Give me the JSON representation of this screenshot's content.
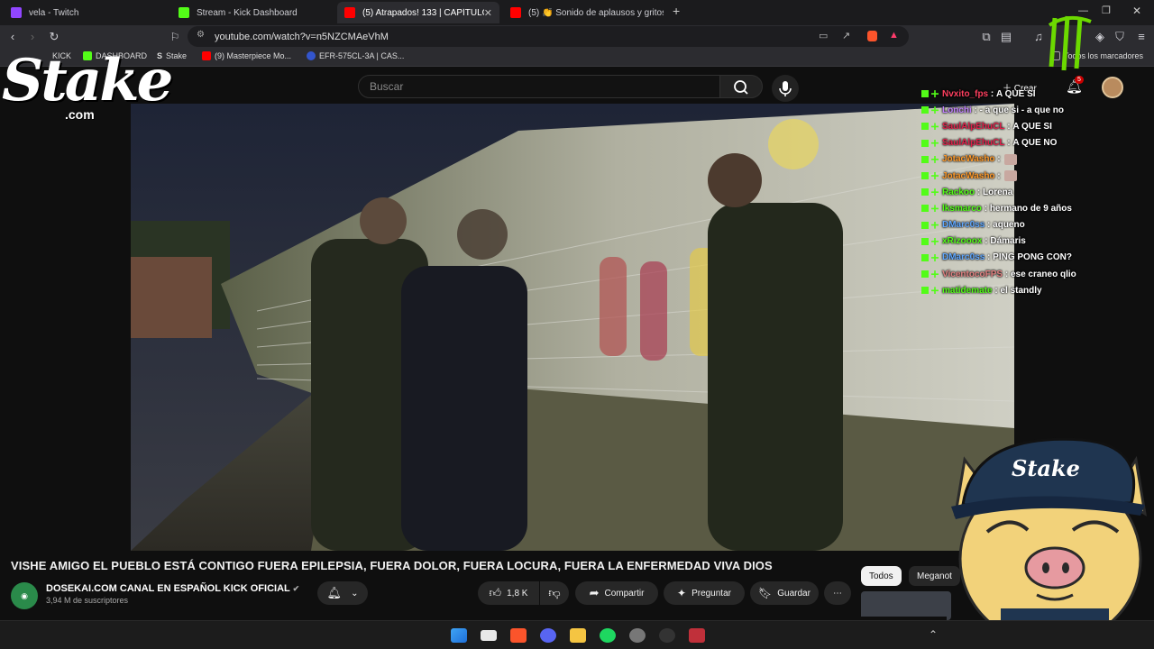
{
  "tabs": [
    {
      "label": "vela - Twitch",
      "icon": "twitch-icon",
      "color": "#9146ff"
    },
    {
      "label": "Stream - Kick Dashboard",
      "icon": "kick-icon",
      "color": "#53fc18"
    },
    {
      "label": "(5) Atrapados! 133 | CAPÍTULO",
      "icon": "youtube-icon",
      "color": "#ff0000"
    },
    {
      "label": "(5) 👏 Sonido de aplausos y gritos de",
      "icon": "youtube-icon",
      "color": "#ff0000"
    }
  ],
  "url": "youtube.com/watch?v=n5NZCMAeVhM",
  "bookmarks": [
    {
      "label": "KICK",
      "color": "#53fc18"
    },
    {
      "label": "DASHBOARD",
      "color": "#53fc18"
    },
    {
      "label": "Stake",
      "color": "#ffffff"
    },
    {
      "label": "(9) Masterpiece Mo...",
      "color": "#ff0000"
    },
    {
      "label": "EFR-575CL-3A | CAS...",
      "color": "#3355cc"
    }
  ],
  "all_bookmarks": "Todos los marcadores",
  "search_placeholder": "Buscar",
  "create_label": "Crear",
  "notif_count": "5",
  "overlay": {
    "logo": "Stake",
    "logo_sub": ".com",
    "cap_text": "Stake"
  },
  "chat": [
    {
      "user": "Nvxito_fps",
      "color": "#ff4060",
      "text": "A QUE SI",
      "emote": false
    },
    {
      "user": "Lonchi",
      "color": "#c080ff",
      "text": "- a que si - a que no",
      "emote": false
    },
    {
      "user": "SaulAlpEhuCL",
      "color": "#e0204a",
      "text": "A QUE SI",
      "emote": false
    },
    {
      "user": "SaulAlpEhuCL",
      "color": "#e0204a",
      "text": "A QUE NO",
      "emote": false
    },
    {
      "user": "JotacWasho",
      "color": "#ff9a2a",
      "text": "",
      "emote": true
    },
    {
      "user": "JotacWasho",
      "color": "#ff9a2a",
      "text": "",
      "emote": true
    },
    {
      "user": "Rackoo",
      "color": "#53fc18",
      "text": "Lorena",
      "emote": false
    },
    {
      "user": "lksmarco",
      "color": "#53fc18",
      "text": "hermano de 9 años",
      "emote": false
    },
    {
      "user": "DMarc0ss",
      "color": "#60a8ff",
      "text": "aqueno",
      "emote": false
    },
    {
      "user": "xRizooox",
      "color": "#53fc18",
      "text": "Dámaris",
      "emote": false
    },
    {
      "user": "DMarc0ss",
      "color": "#60a8ff",
      "text": "PING PONG CON?",
      "emote": false
    },
    {
      "user": "VicentocoFPS",
      "color": "#e08080",
      "text": "ese craneo qlio",
      "emote": false
    },
    {
      "user": "matidemate",
      "color": "#53fc18",
      "text": "el standly",
      "emote": false
    }
  ],
  "video_title": "VISHE AMIGO EL PUEBLO ESTÁ CONTIGO FUERA EPILEPSIA, FUERA DOLOR, FUERA LOCURA, FUERA LA ENFERMEDAD VIVA DIOS",
  "channel": {
    "name": "DOSEKAI.COM CANAL EN ESPAÑOL KICK OFICIAL",
    "subs": "3,94 M de suscriptores"
  },
  "actions": {
    "likes": "1,8 K",
    "share": "Compartir",
    "ask": "Preguntar",
    "save": "Guardar"
  },
  "chips": [
    "Todos",
    "Meganot"
  ]
}
